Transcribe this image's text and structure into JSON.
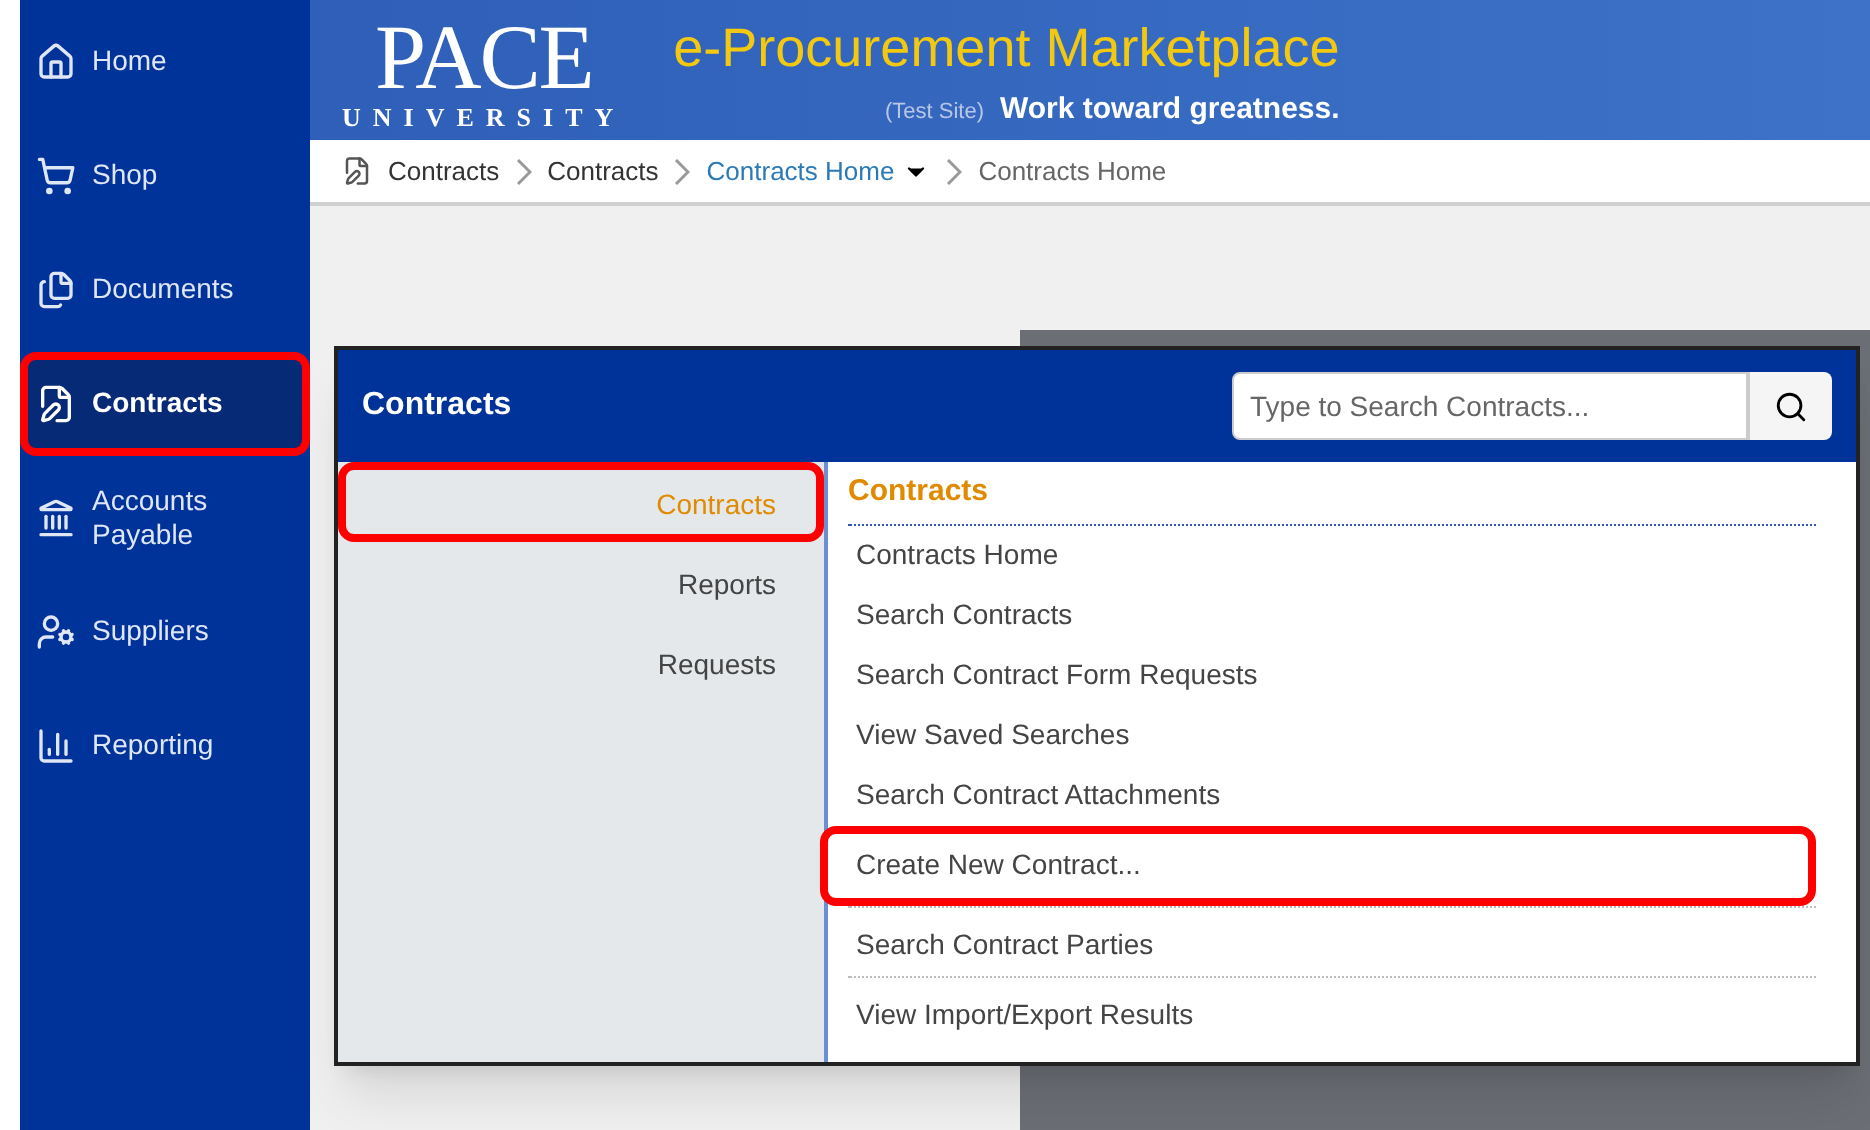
{
  "sidebar": {
    "items": [
      {
        "label": "Home",
        "selected": false,
        "highlighted": false
      },
      {
        "label": "Shop",
        "selected": false,
        "highlighted": false
      },
      {
        "label": "Documents",
        "selected": false,
        "highlighted": false
      },
      {
        "label": "Contracts",
        "selected": true,
        "highlighted": true
      },
      {
        "label": "Accounts Payable",
        "selected": false,
        "highlighted": false
      },
      {
        "label": "Suppliers",
        "selected": false,
        "highlighted": false
      },
      {
        "label": "Reporting",
        "selected": false,
        "highlighted": false
      }
    ]
  },
  "header": {
    "logo_main": "PACE",
    "logo_sub": "UNIVERSITY",
    "title": "e-Procurement Marketplace",
    "site_note": "(Test Site)",
    "tagline": "Work toward greatness."
  },
  "breadcrumb": [
    {
      "label": "Contracts",
      "kind": "plain"
    },
    {
      "label": "Contracts",
      "kind": "plain"
    },
    {
      "label": "Contracts Home",
      "kind": "dropdown"
    },
    {
      "label": "Contracts Home",
      "kind": "current"
    }
  ],
  "flyout": {
    "title": "Contracts",
    "search": {
      "placeholder": "Type to Search Contracts..."
    },
    "categories": [
      {
        "label": "Contracts",
        "selected": true,
        "highlighted": true
      },
      {
        "label": "Reports",
        "selected": false,
        "highlighted": false
      },
      {
        "label": "Requests",
        "selected": false,
        "highlighted": false
      }
    ],
    "section_title": "Contracts",
    "links": [
      {
        "label": "Contracts Home",
        "highlighted": false,
        "divider_after": false
      },
      {
        "label": "Search Contracts",
        "highlighted": false,
        "divider_after": false
      },
      {
        "label": "Search Contract Form Requests",
        "highlighted": false,
        "divider_after": false
      },
      {
        "label": "View Saved Searches",
        "highlighted": false,
        "divider_after": false
      },
      {
        "label": "Search Contract Attachments",
        "highlighted": false,
        "divider_after": false
      },
      {
        "label": "Create New Contract...",
        "highlighted": true,
        "divider_after": true
      },
      {
        "label": "Search Contract Parties",
        "highlighted": false,
        "divider_after": true
      },
      {
        "label": "View Import/Export Results",
        "highlighted": false,
        "divider_after": false
      }
    ]
  }
}
